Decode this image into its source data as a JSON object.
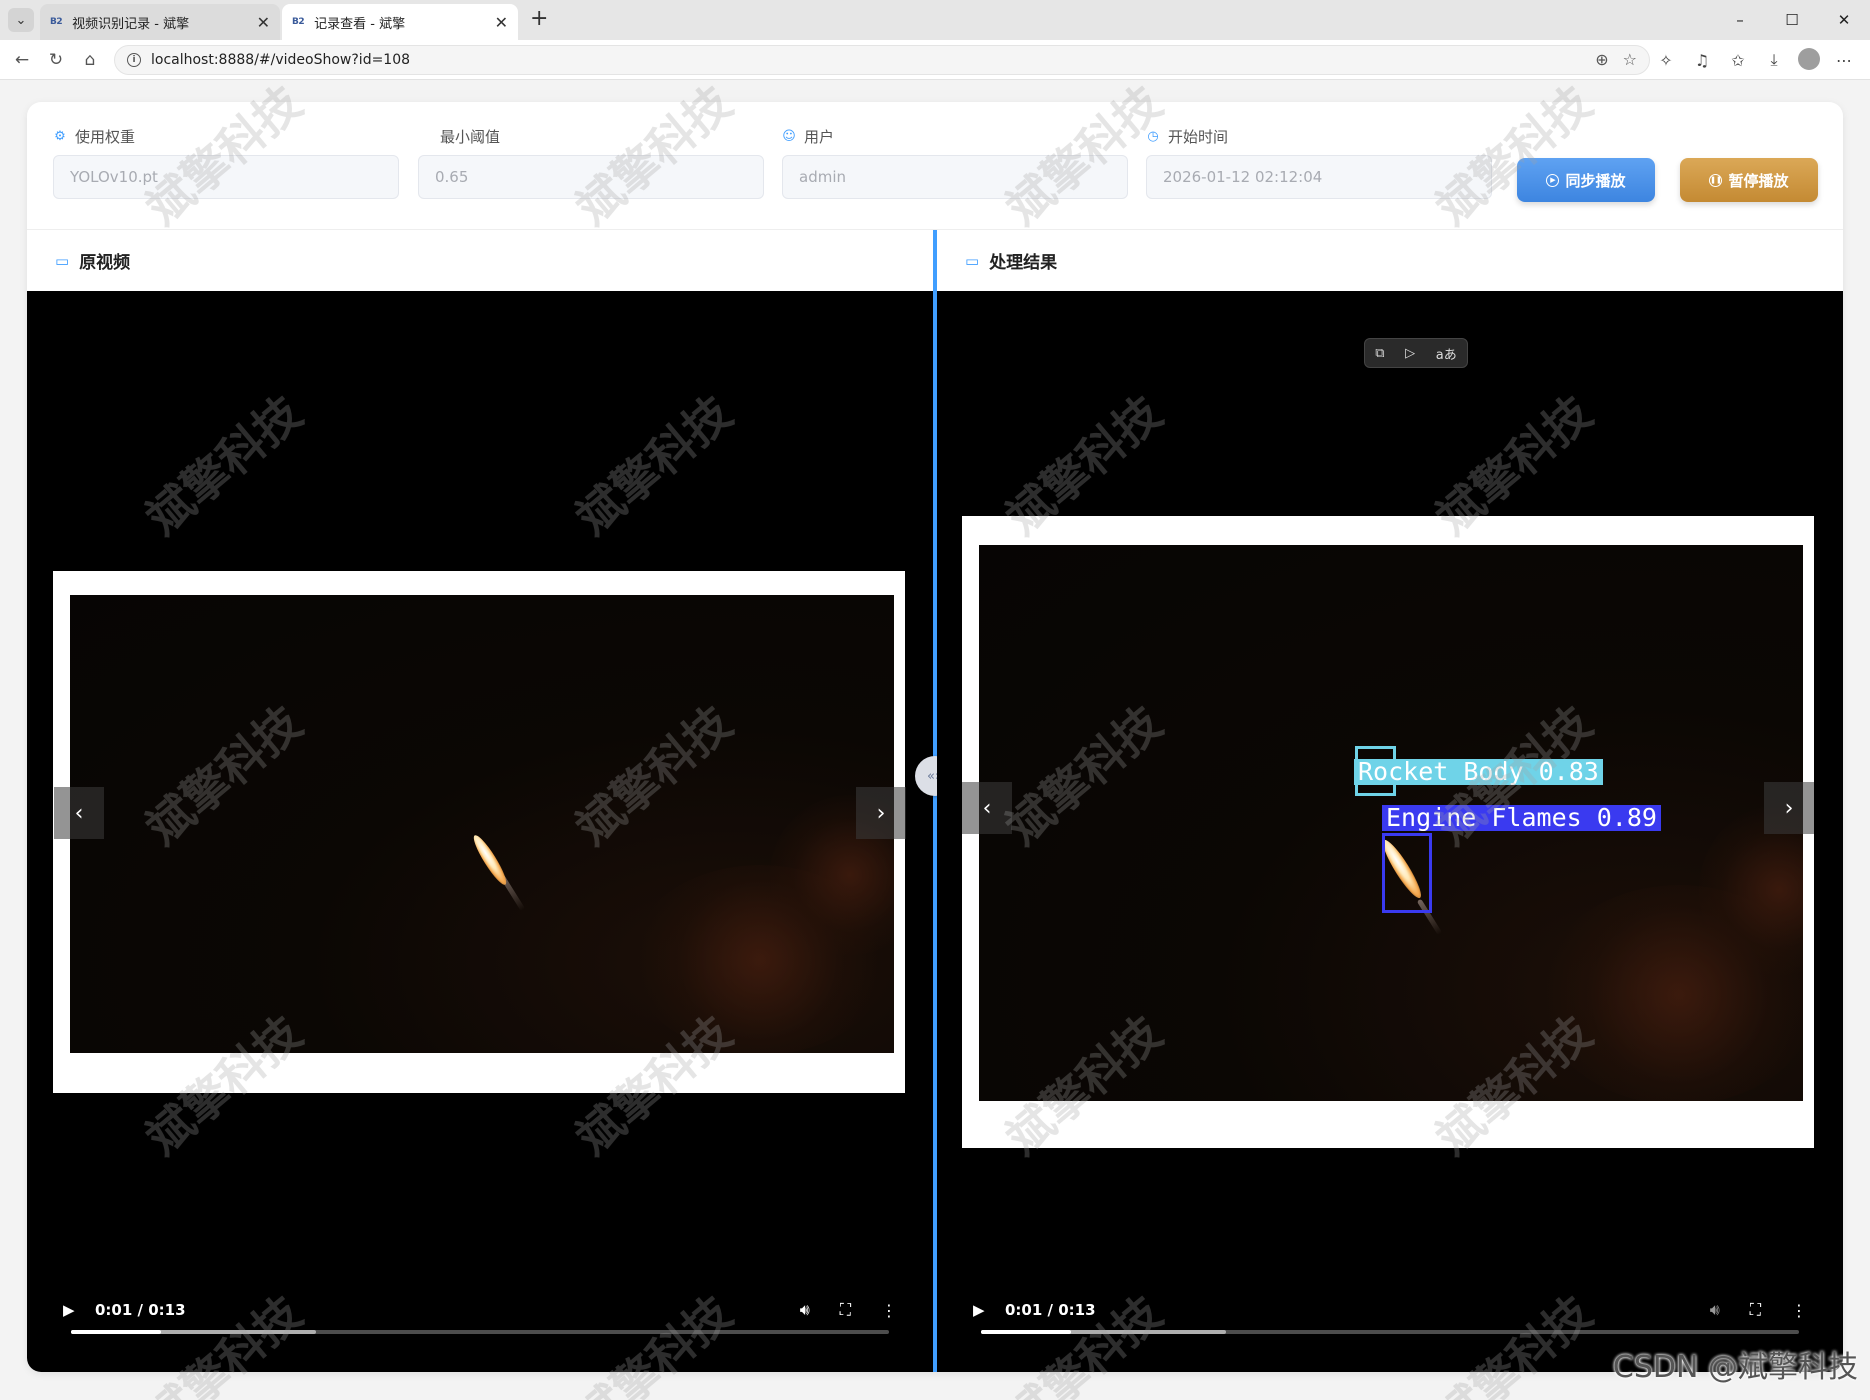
{
  "browser": {
    "tabs": [
      {
        "favicon": "B2",
        "title": "视频识别记录 - 斌擎",
        "active": false
      },
      {
        "favicon": "B2",
        "title": "记录查看 - 斌擎",
        "active": true
      }
    ],
    "url": "localhost:8888/#/videoShow?id=108"
  },
  "filters": {
    "weight": {
      "label": "使用权重",
      "value": "YOLOv10.pt",
      "icon": "gear-icon"
    },
    "threshold": {
      "label": "最小阈值",
      "value": "0.65"
    },
    "user": {
      "label": "用户",
      "value": "admin",
      "icon": "user-icon"
    },
    "start_time": {
      "label": "开始时间",
      "value": "2026-01-12 02:12:04",
      "icon": "clock-icon"
    }
  },
  "buttons": {
    "sync_play": "同步播放",
    "pause_play": "暂停播放"
  },
  "panels": {
    "original": {
      "title": "原视频",
      "icon": "video-camera-icon"
    },
    "result": {
      "title": "处理结果",
      "icon": "monitor-icon"
    }
  },
  "player": {
    "time": "0:01 / 0:13",
    "played_fraction": 0.11,
    "buffered_fraction": 0.3
  },
  "detections": [
    {
      "label": "Rocket Body 0.83",
      "color": "#6fd3e8"
    },
    {
      "label": "Engine Flames 0.89",
      "color": "#3a3af0"
    }
  ],
  "watermark": "斌擎科技",
  "footer_credit": "CSDN @斌擎科技",
  "colors": {
    "accent": "#409eff",
    "sync_button": "#4a90e2",
    "pause_button": "#d09a45"
  }
}
